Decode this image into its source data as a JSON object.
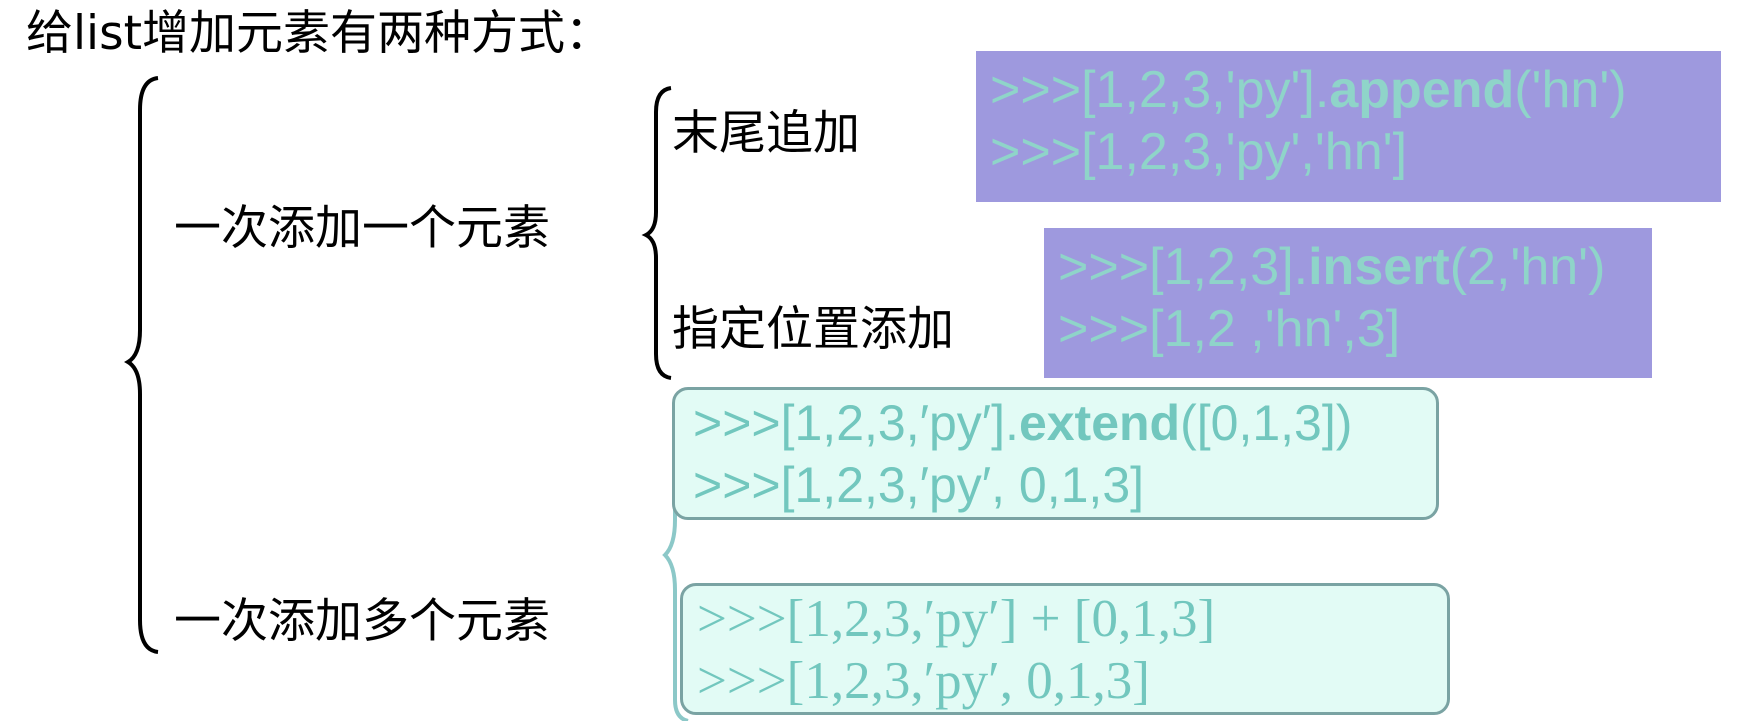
{
  "title": "给list增加元素有两种方式：",
  "branches": {
    "single": {
      "label": "一次添加一个元素",
      "append": {
        "label": "末尾追加",
        "code_line1_prefix": ">>>[1,2,3,'py'].",
        "code_line1_method": "append",
        "code_line1_suffix": "('hn')",
        "code_line2": ">>>[1,2,3,'py','hn']"
      },
      "insert": {
        "label": "指定位置添加",
        "code_line1_prefix": ">>>[1,2,3].",
        "code_line1_method": "insert",
        "code_line1_suffix": "(2,'hn')",
        "code_line2": ">>>[1,2 ,'hn',3]"
      }
    },
    "multiple": {
      "label": "一次添加多个元素",
      "extend": {
        "code_line1_prefix": ">>>[1,2,3,′py′].",
        "code_line1_method": "extend",
        "code_line1_suffix": "([0,1,3])",
        "code_line2": ">>>[1,2,3,′py′, 0,1,3]"
      },
      "concat": {
        "code_line1": ">>>[1,2,3,′py′] + [0,1,3]",
        "code_line2": ">>>[1,2,3,′py′, 0,1,3]"
      }
    }
  },
  "colors": {
    "purple_box": "#9e99de",
    "purple_text": "#8fd4c9",
    "mint_box": "#e2fbf5",
    "mint_border": "#7aa3a3",
    "mint_text": "#72c7be",
    "brace_light": "#8cc8c8"
  }
}
